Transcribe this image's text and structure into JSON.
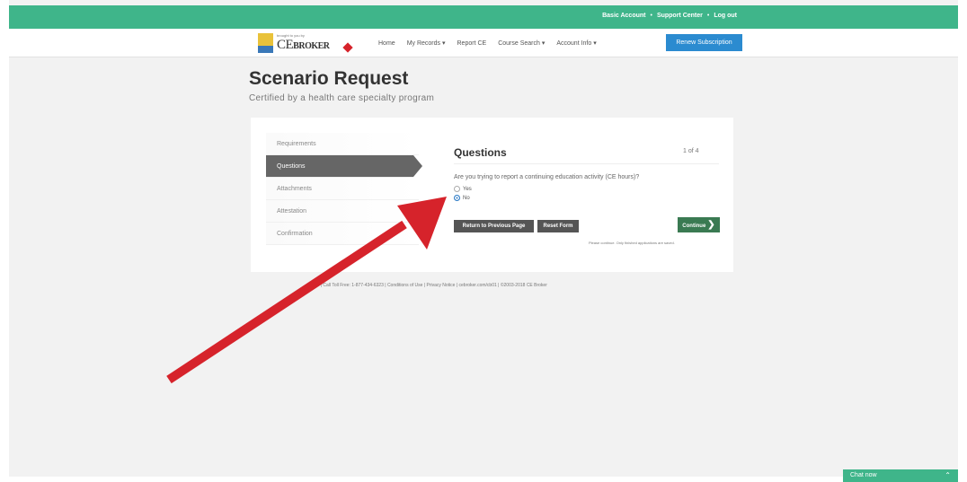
{
  "topbar": {
    "links": [
      "Basic Account",
      "Support Center",
      "Log out"
    ],
    "separator": "•"
  },
  "navbar": {
    "logo_small_text": "brought to you by",
    "logo_ce": "CE",
    "logo_broker": "BROKER",
    "items": [
      "Home",
      "My Records ▾",
      "Report CE",
      "Course Search ▾",
      "Account Info ▾"
    ],
    "renew_label": "Renew Subscription"
  },
  "page": {
    "title": "Scenario Request",
    "subtitle": "Certified by a health care specialty program"
  },
  "steps": [
    {
      "label": "Requirements",
      "active": false
    },
    {
      "label": "Questions",
      "active": true
    },
    {
      "label": "Attachments",
      "active": false
    },
    {
      "label": "Attestation",
      "active": false
    },
    {
      "label": "Confirmation",
      "active": false
    }
  ],
  "question": {
    "title": "Questions",
    "count": "1 of 4",
    "text": "Are you trying to report a continuing education activity (CE hours)?",
    "options": [
      {
        "label": "Yes",
        "checked": false
      },
      {
        "label": "No",
        "checked": true
      }
    ]
  },
  "buttons": {
    "prev": "Return to Previous Page",
    "reset": "Reset Form",
    "continue": "Continue",
    "continue_chevron": "❯"
  },
  "note": "Please continue. Only finished applications are saved.",
  "footer": "Home | Call Toll Free: 1-877-434-6323 | Conditions of Use | Privacy Notice | cebroker.com/cb01 | ©2003-2018 CE Broker",
  "chat": {
    "label": "Chat now",
    "caret": "⌃"
  },
  "colors": {
    "topbar": "#3fb58a",
    "renew_button": "#2b8bd0",
    "continue_button": "#3a7a52",
    "active_step": "#666666",
    "annotation_arrow": "#d6232b"
  }
}
